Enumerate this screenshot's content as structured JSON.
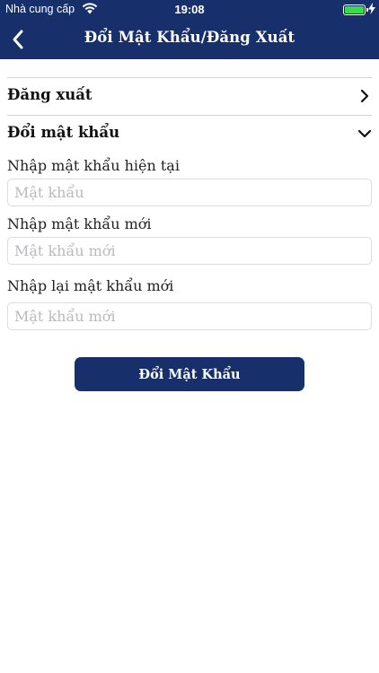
{
  "status_bar": {
    "carrier": "Nhà cung cấp",
    "time": "19:08",
    "battery_color": "#3adb4a"
  },
  "nav": {
    "title": "Đổi Mật Khẩu/Đăng Xuất",
    "back_icon": "chevron-left-icon",
    "background": "#17306b"
  },
  "menu": {
    "logout_label": "Đăng xuất",
    "logout_icon": "chevron-right-icon",
    "change_password_label": "Đổi mật khẩu",
    "change_password_icon": "chevron-down-icon"
  },
  "form": {
    "current_label": "Nhập mật khẩu hiện tại",
    "current_placeholder": "Mật khẩu",
    "new_label": "Nhập mật khẩu mới",
    "new_placeholder": "Mật khẩu mới",
    "confirm_label": "Nhập lại mật khẩu mới",
    "confirm_placeholder": "Mật khẩu mới",
    "submit_label": "Đổi Mật Khẩu"
  }
}
